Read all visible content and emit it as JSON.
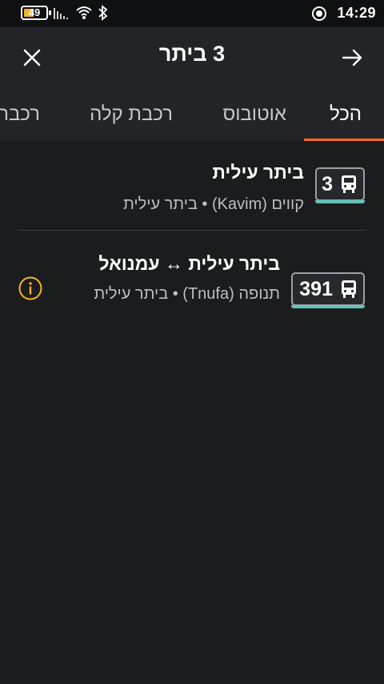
{
  "status_bar": {
    "battery_level": "49",
    "time": "14:29",
    "icons": [
      "battery-icon",
      "cell-signal-icon",
      "wifi-icon",
      "bluetooth-icon",
      "location-icon"
    ]
  },
  "app_bar": {
    "title": "3 ביתר",
    "close_icon": "close-icon",
    "back_icon": "arrow-right-icon"
  },
  "tabs": [
    {
      "label": "הכל",
      "active": true
    },
    {
      "label": "אוטובוס",
      "active": false
    },
    {
      "label": "רכבת קלה",
      "active": false
    },
    {
      "label": "רכבת",
      "active": false
    }
  ],
  "results": [
    {
      "line_number": "3",
      "title": "ביתר עילית",
      "subtitle": "קווים (Kavim) • ביתר עילית",
      "badge_color": "#5fc4b8",
      "has_info": false
    },
    {
      "line_number": "391",
      "title": "ביתר עילית ↔ עמנואל",
      "subtitle": "תנופה (Tnufa) • ביתר עילית",
      "badge_color": "#5fc4b8",
      "has_info": true
    }
  ],
  "colors": {
    "accent": "#ff6b1a",
    "info": "#f5b52a",
    "background": "#1b1c1e",
    "header": "#232427"
  }
}
